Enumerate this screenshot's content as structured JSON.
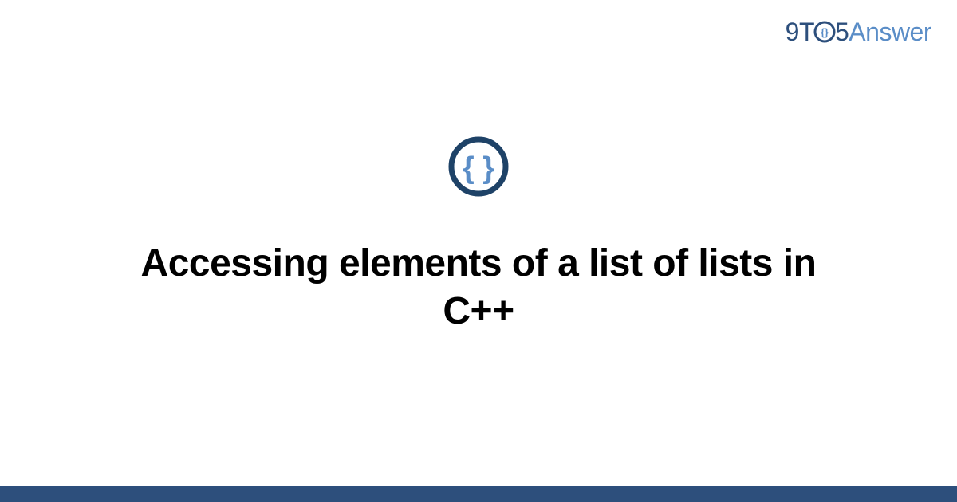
{
  "logo": {
    "part1": "9T",
    "part2": "5",
    "part3": "Answer"
  },
  "main": {
    "title": "Accessing elements of a list of lists in C++"
  },
  "colors": {
    "primary": "#2d4f7c",
    "accent": "#5a8dc7"
  }
}
